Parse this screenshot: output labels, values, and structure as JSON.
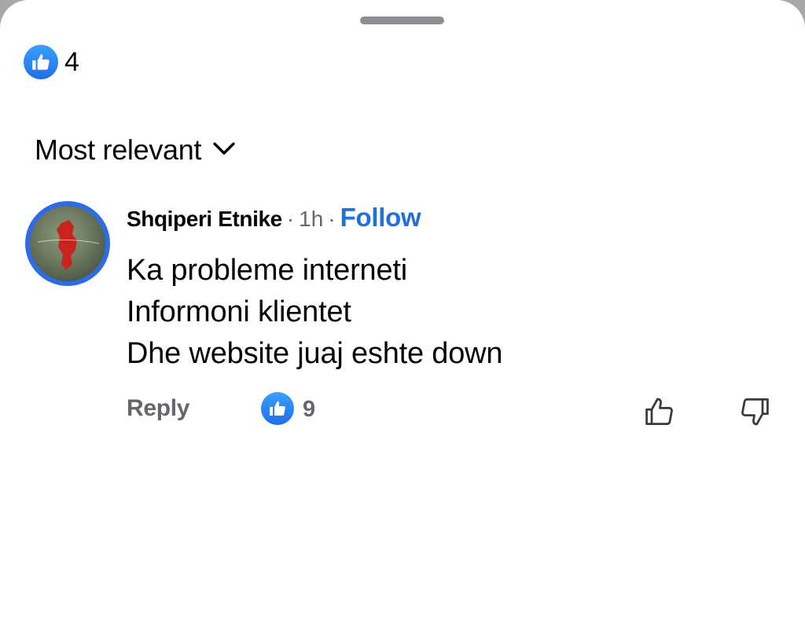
{
  "reactions_summary": {
    "icon": "thumbs-up-icon",
    "count": "4"
  },
  "sort": {
    "label": "Most relevant",
    "icon": "chevron-down-icon"
  },
  "comment": {
    "avatar_icon": "avatar-map-of-albania",
    "author": "Shqiperi Etnike",
    "separator": "·",
    "time": "1h",
    "follow_label": "Follow",
    "lines": [
      "Ka probleme interneti",
      "Informoni klientet",
      "Dhe website juaj eshte down"
    ],
    "reply_label": "Reply",
    "reaction_icon": "thumbs-up-icon",
    "reaction_count": "9",
    "like_action_icon": "thumbs-up-outline-icon",
    "dislike_action_icon": "thumbs-down-outline-icon"
  },
  "colors": {
    "accent": "#216fdb",
    "like_badge": "#2a83f5",
    "secondary_text": "#65676b",
    "primary_text": "#050505"
  }
}
